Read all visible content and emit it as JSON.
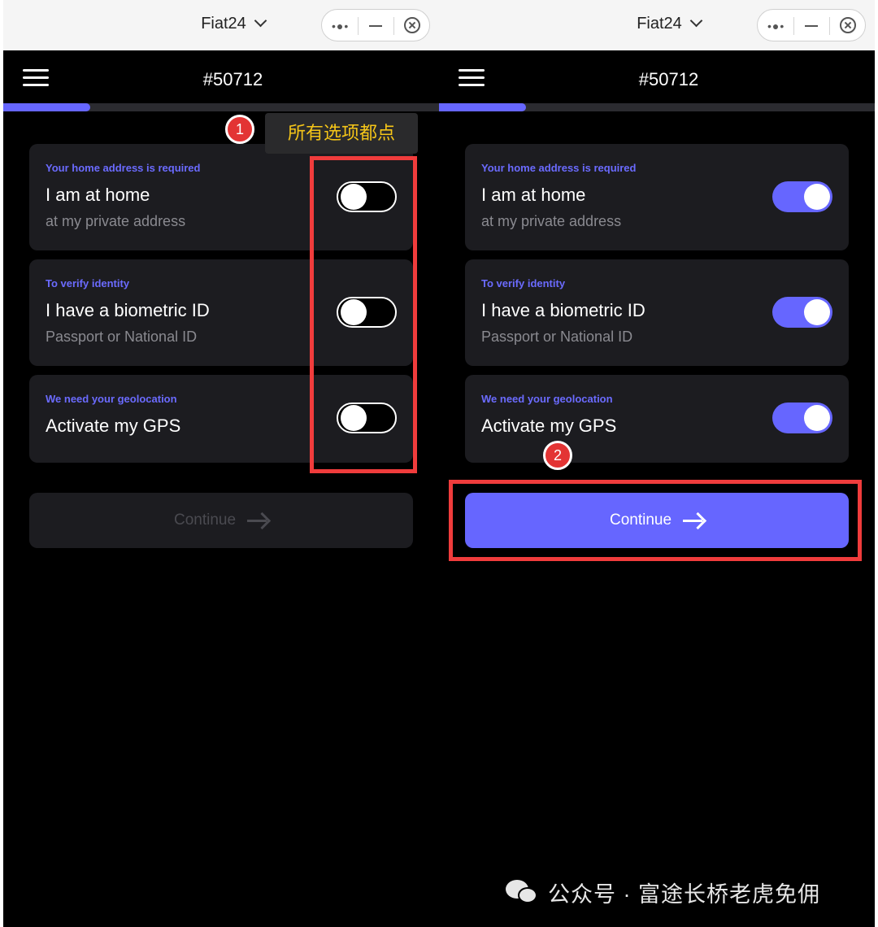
{
  "panels": {
    "left": {
      "app_title": "Fiat24",
      "order_id": "#50712",
      "progress": 0.2,
      "items": [
        {
          "hint": "Your home address is required",
          "title": "I am at home",
          "sub": "at my private address",
          "enabled": false
        },
        {
          "hint": "To verify identity",
          "title": "I have a biometric ID",
          "sub": "Passport or National ID",
          "enabled": false
        },
        {
          "hint": "We need your geolocation",
          "title": "Activate my GPS",
          "sub": "",
          "enabled": false
        }
      ],
      "continue_label": "Continue",
      "continue_enabled": false
    },
    "right": {
      "app_title": "Fiat24",
      "order_id": "#50712",
      "progress": 0.2,
      "items": [
        {
          "hint": "Your home address is required",
          "title": "I am at home",
          "sub": "at my private address",
          "enabled": true
        },
        {
          "hint": "To verify identity",
          "title": "I have a biometric ID",
          "sub": "Passport or National ID",
          "enabled": true
        },
        {
          "hint": "We need your geolocation",
          "title": "Activate my GPS",
          "sub": "",
          "enabled": true
        }
      ],
      "continue_label": "Continue",
      "continue_enabled": true
    }
  },
  "annotations": {
    "step1": "1",
    "step1_text": "所有选项都点",
    "step2": "2"
  },
  "watermark": "公众号 · 富途长桥老虎免佣",
  "colors": {
    "accent": "#6666ff",
    "background": "#000000",
    "card": "#1c1c20",
    "annotation_red": "#f03c3c",
    "annotation_text": "#f5c518"
  }
}
